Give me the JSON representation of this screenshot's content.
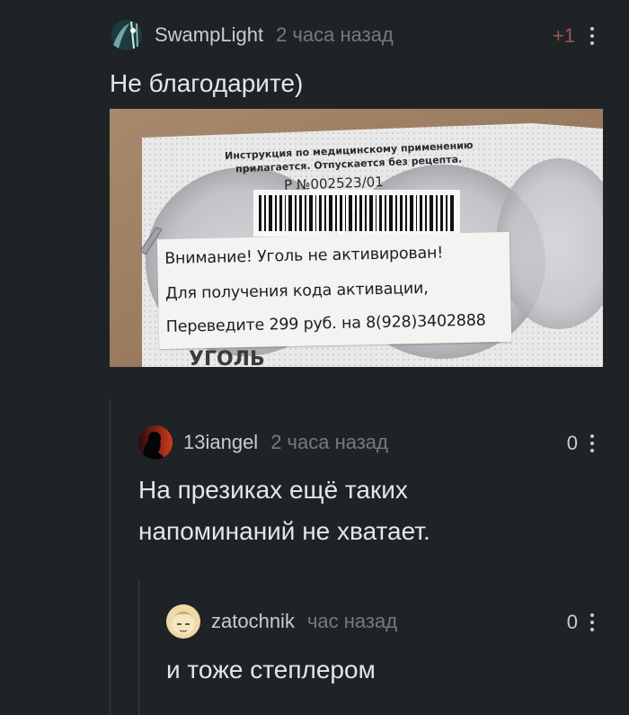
{
  "comments": [
    {
      "username": "SwampLight",
      "time": "2 часа назад",
      "rating": "+1",
      "text": "Не благодарите)",
      "image": {
        "package_line_1": "Инструкция по медицинскому применению",
        "package_line_2": "прилагается. Отпускается без рецепта.",
        "package_reg": "Р №002523/01",
        "package_bottom": "УГОЛЬ",
        "sticker_line_1": "Внимание! Уголь не активирован!",
        "sticker_line_2": "Для получения кода активации,",
        "sticker_line_3": "Переведите 299 руб. на 8(928)3402888"
      }
    },
    {
      "username": "13iangel",
      "time": "2 часа назад",
      "rating": "0",
      "text_line_1": "На презиках ещё таких",
      "text_line_2": "напоминаний не хватает."
    },
    {
      "username": "zatochnik",
      "time": "час назад",
      "rating": "0",
      "text": "и тоже степлером"
    }
  ],
  "colors": {
    "background": "#202326",
    "positive_rating": "#9b5652",
    "thread_line": "#3a3e43"
  }
}
